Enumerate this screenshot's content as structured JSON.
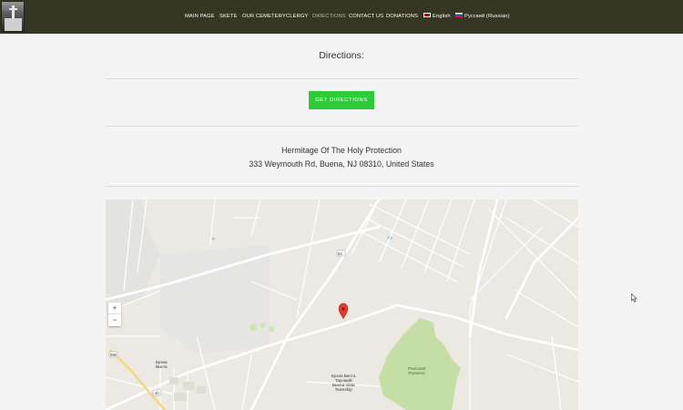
{
  "nav": {
    "items": [
      "MAIN PAGE",
      "SKETE",
      "OUR CEMETERY",
      "CLERGY",
      "DIRECTIONS",
      "CONTACT US",
      "DONATIONS"
    ],
    "lang_en": "English",
    "lang_ru": "Русский (Russian)",
    "active": "DIRECTIONS"
  },
  "page": {
    "heading": "Directions:",
    "button_label": "GET DIRECTIONS",
    "place_name": "Hermitage Of The Holy Protection",
    "address": "333 Weymouth Rd, Buena, NJ 08310, United States"
  },
  "map": {
    "zoom_in": "+",
    "zoom_out": "−",
    "labels": {
      "buena": "Буэна\nВиста",
      "buena_vista": "Буэна Виста\nТаунший\nBuena Vista\nTownship",
      "pancoast": "Pancoast\nPreserve",
      "route_40": "40",
      "route_54": "54",
      "route_690": "690"
    },
    "colors": {
      "background": "#ebe9e1",
      "preserve": "#c5dea5",
      "road": "#ffffff",
      "highway": "#f6d67a",
      "pin": "#e03a2f"
    }
  }
}
